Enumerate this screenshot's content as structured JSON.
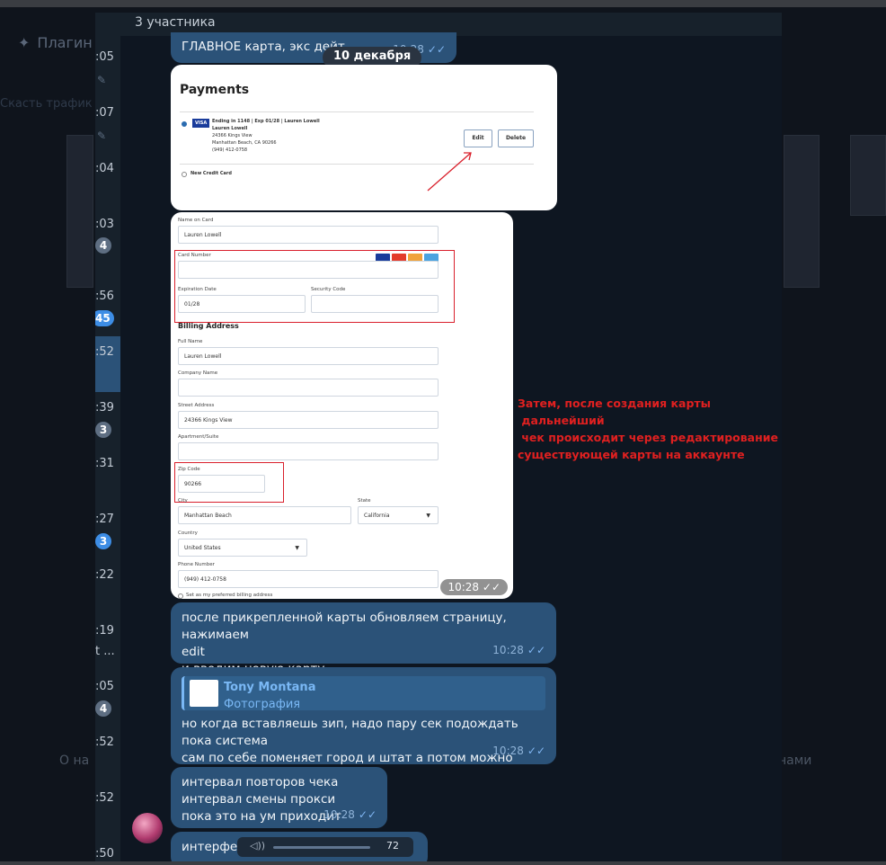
{
  "background": {
    "plugins_label": "Плагин",
    "left_text": "Скасть трафик",
    "about_text": "О на",
    "with_us_text": "нами"
  },
  "chat_list": {
    "times": [
      ":05",
      ":07",
      ":04",
      ":03",
      ":56",
      ":52",
      ":39",
      ":31",
      ":27",
      ":22",
      ":19",
      ":05",
      ":52",
      ":52",
      ":50"
    ],
    "badges": [
      "4",
      "45",
      "3",
      "3",
      "4"
    ],
    "snippet": "t ..."
  },
  "chat": {
    "header_title": "3 участника",
    "date_pill": "10 декабря",
    "messages": [
      {
        "text": "ГЛАВНОЕ карта, экс дейт, ",
        "time": "10:28"
      },
      {
        "text_lines": [
          "после прикрепленной карты обновляем страницу, нажимаем",
          "edit",
          "и вводим новую карту"
        ],
        "time": "10:28"
      },
      {
        "reply_name": "Tony Montana",
        "reply_type": "Фотография",
        "text_lines": [
          "но когда вставляешь зип, надо пару сек подождать пока система",
          "сам по себе поменяет город и штат а потом можно нажать на ок"
        ],
        "time": "10:28"
      },
      {
        "text_lines": [
          "интервал повторов чека",
          "интервал смены прокси",
          "пока это на ум приходит"
        ],
        "time": "10:28"
      },
      {
        "text": "интерфейс"
      }
    ],
    "image_time": "10:28",
    "annotation": "Затем, после создания карты\n дальнейший\n чек происходит через редактирование\nсуществующей карты на аккаунте",
    "player_value": "72"
  },
  "payments": {
    "title": "Payments",
    "card_brand": "VISA",
    "card_line": "Ending in 1148 | Exp 01/28 | Lauren Lowell",
    "name": "Lauren Lowell",
    "addr1": "24366 Kings View",
    "addr2": "Manhattan Beach, CA 90266",
    "phone": "(949) 412-0758",
    "edit_label": "Edit",
    "delete_label": "Delete",
    "new_card_label": "New Credit Card"
  },
  "form": {
    "name_on_card_label": "Name on Card",
    "name_on_card": "Lauren Lowell",
    "card_number_label": "Card Number",
    "card_number": "",
    "exp_label": "Expiration Date",
    "exp": "01/28",
    "cvv_label": "Security Code",
    "cvv": "",
    "billing_heading": "Billing Address",
    "full_name_label": "Full Name",
    "full_name": "Lauren Lowell",
    "company_label": "Company Name",
    "company": "",
    "street_label": "Street Address",
    "street": "24366 Kings View",
    "apt_label": "Apartment/Suite",
    "apt": "",
    "zip_label": "Zip Code",
    "zip": "90266",
    "city_label": "City",
    "city": "Manhattan Beach",
    "state_label": "State",
    "state": "California",
    "country_label": "Country",
    "country": "United States",
    "phone_label": "Phone Number",
    "phone": "(949) 412-0758",
    "preferred_label": "Set as my preferred billing address"
  },
  "colors": {
    "bubble": "#2b5278",
    "chat_bg": "#0e1621",
    "annotation": "#e02020",
    "tick": "#7fb4f0"
  }
}
